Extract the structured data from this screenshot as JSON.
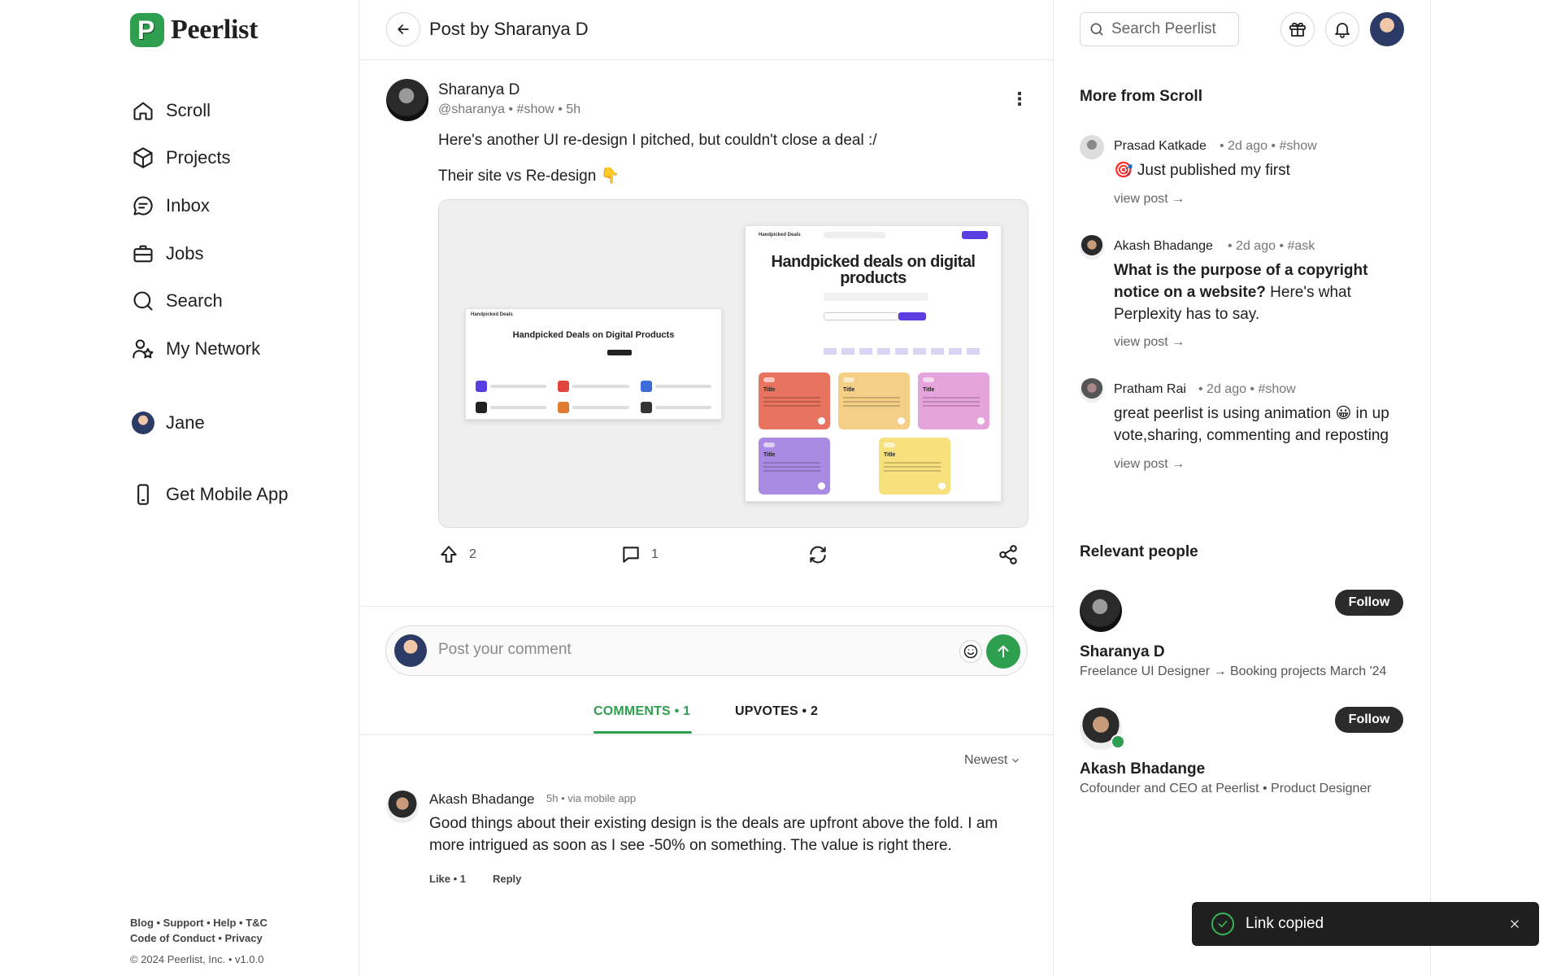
{
  "brand": {
    "name": "Peerlist",
    "color": "#2e9e4f"
  },
  "nav": {
    "items": [
      {
        "label": "Scroll",
        "icon": "home-icon"
      },
      {
        "label": "Projects",
        "icon": "cube-icon"
      },
      {
        "label": "Inbox",
        "icon": "chat-icon"
      },
      {
        "label": "Jobs",
        "icon": "briefcase-icon"
      },
      {
        "label": "Search",
        "icon": "search-icon"
      },
      {
        "label": "My Network",
        "icon": "network-icon"
      }
    ],
    "profile": "Jane",
    "mobile_app": "Get Mobile App"
  },
  "footer": {
    "line1": "Blog • Support • Help • T&C",
    "line2": "Code of Conduct • Privacy",
    "line3": "© 2024 Peerlist, Inc. • v1.0.0"
  },
  "post": {
    "page_title": "Post by Sharanya D",
    "author": "Sharanya D",
    "meta": "@sharanya • #show • 5h",
    "text1": "Here's another UI re-design I pitched, but couldn't close a deal :/",
    "text2": "Their site vs Re-design 👇",
    "image": {
      "small_logo": "Handpicked Deals",
      "small_title": "Handpicked Deals on Digital Products",
      "big_logo": "Handpicked Deals",
      "big_title": "Handpicked deals on digital products",
      "card_label": "Title"
    },
    "upvotes": "2",
    "comments": "1"
  },
  "comment_box": {
    "placeholder": "Post your comment"
  },
  "tabs": {
    "comments": "COMMENTS • 1",
    "upvotes": "UPVOTES • 2"
  },
  "sort": "Newest",
  "comment": {
    "author": "Akash Bhadange",
    "meta": "5h • via mobile app",
    "text": "Good things about their existing design is the deals are upfront above the fold. I am more intrigued as soon as I see -50% on something. The value is right there.",
    "like": "Like • 1",
    "reply": "Reply"
  },
  "right": {
    "search_placeholder": "Search Peerlist",
    "more_title": "More from Scroll",
    "more": [
      {
        "name": "Prasad Katkade",
        "meta": "• 2d ago • #show",
        "text": "🎯 Just published my first",
        "link": "view post →"
      },
      {
        "name": "Akash Bhadange",
        "meta": "• 2d ago • #ask",
        "text_bold": "What is the purpose of a copyright notice on a website?",
        "text": " Here's what Perplexity has to say.",
        "link": "view post →"
      },
      {
        "name": "Pratham Rai",
        "meta": "• 2d ago • #show",
        "text": "great peerlist is using animation 😀 in up vote,sharing, commenting and reposting",
        "link": "view post →"
      }
    ],
    "people_title": "Relevant people",
    "people": [
      {
        "name": "Sharanya D",
        "bio": "Freelance UI Designer → Booking projects March '24",
        "follow": "Follow"
      },
      {
        "name": "Akash Bhadange",
        "bio": "Cofounder and CEO at Peerlist • Product Designer",
        "follow": "Follow"
      }
    ]
  },
  "toast": {
    "message": "Link copied"
  }
}
